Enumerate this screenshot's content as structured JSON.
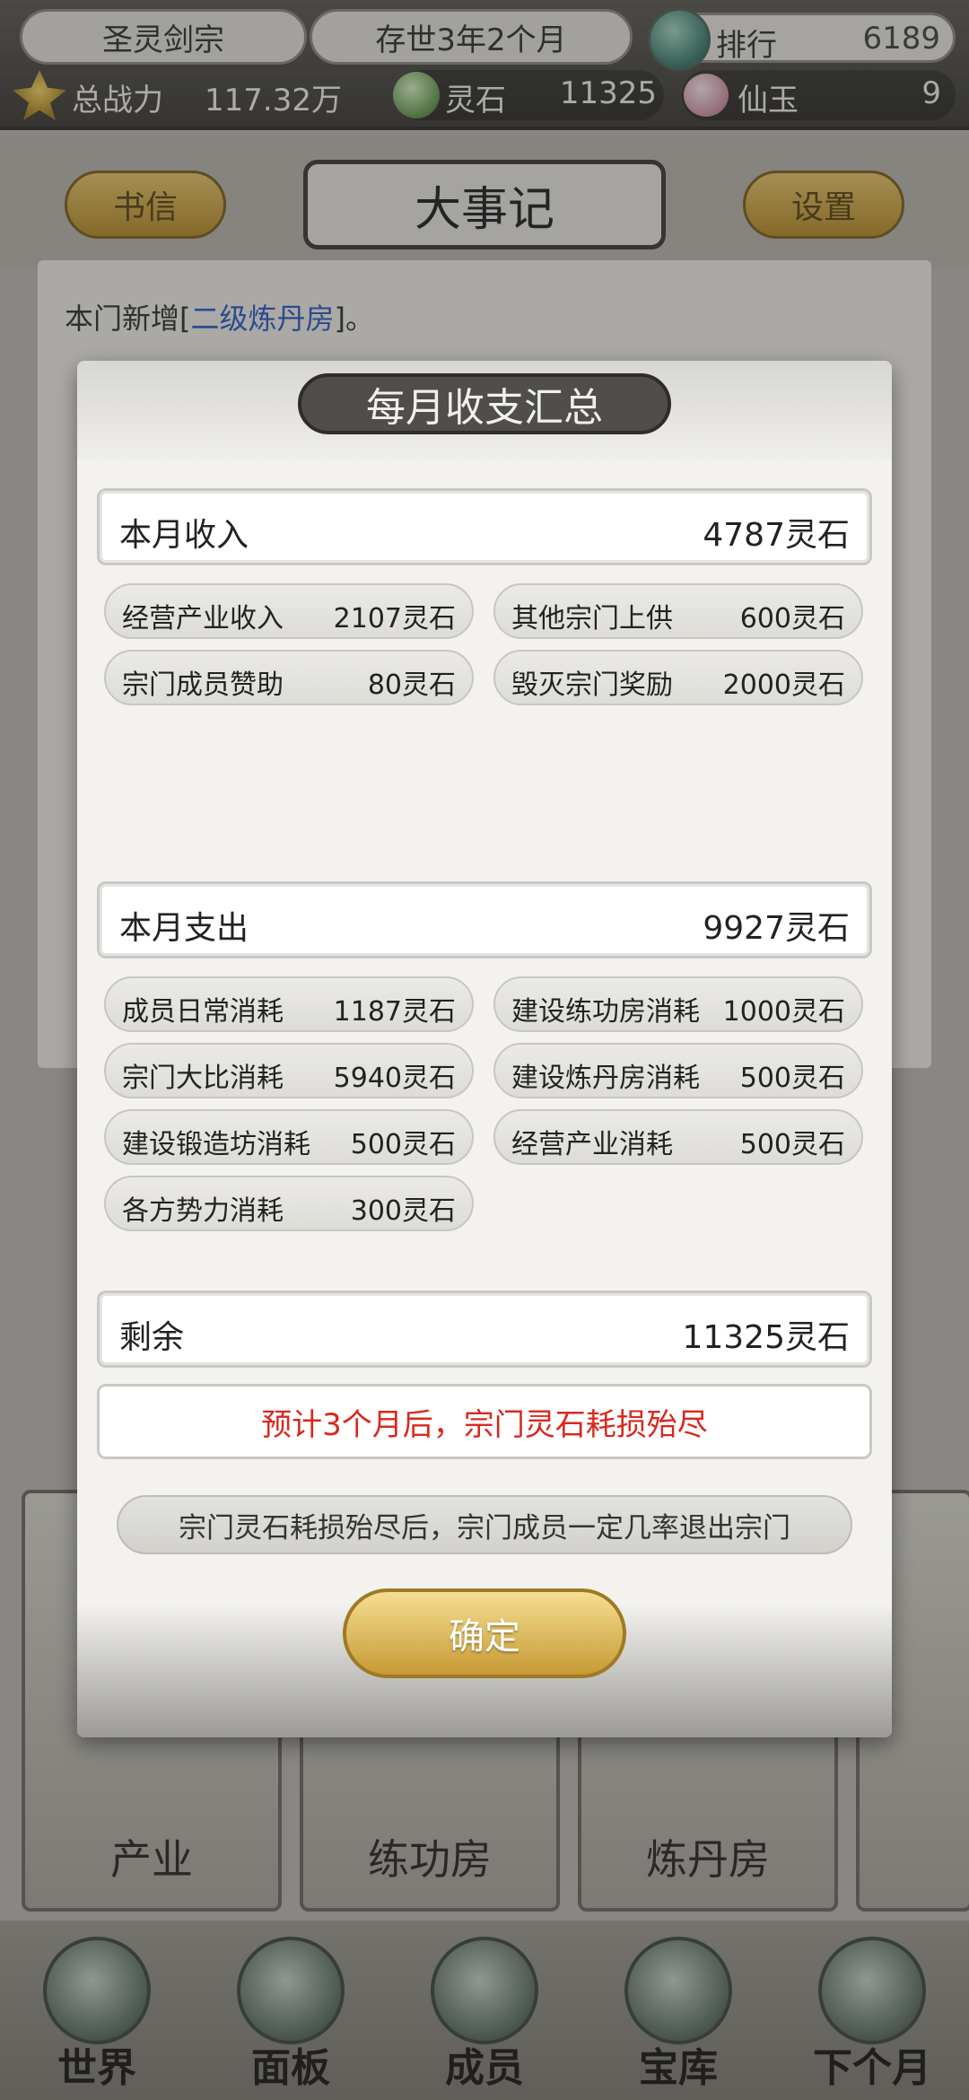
{
  "topbar": {
    "sect_name": "圣灵剑宗",
    "era": "存世3年2个月",
    "rank_label": "排行",
    "rank_value": "6189",
    "power_label": "总战力",
    "power_value": "117.32万",
    "stone_label": "灵石",
    "stone_value": "11325",
    "jade_label": "仙玉",
    "jade_value": "9"
  },
  "header": {
    "letters_button": "书信",
    "title": "大事记",
    "settings_button": "设置"
  },
  "log": {
    "line1_prefix": "本门新增[",
    "line1_highlight": "二级炼丹房",
    "line1_suffix": "]。"
  },
  "buildings": [
    {
      "label": "产业"
    },
    {
      "label": "练功房"
    },
    {
      "label": "炼丹房"
    }
  ],
  "nav": [
    {
      "label": "世界"
    },
    {
      "label": "面板"
    },
    {
      "label": "成员"
    },
    {
      "label": "宝库"
    },
    {
      "label": "下个月"
    }
  ],
  "modal": {
    "title": "每月收支汇总",
    "income": {
      "label": "本月收入",
      "total": "4787灵石",
      "items": [
        {
          "label": "经营产业收入",
          "value": "2107灵石"
        },
        {
          "label": "其他宗门上供",
          "value": "600灵石"
        },
        {
          "label": "宗门成员赞助",
          "value": "80灵石"
        },
        {
          "label": "毁灭宗门奖励",
          "value": "2000灵石"
        }
      ]
    },
    "expense": {
      "label": "本月支出",
      "total": "9927灵石",
      "items": [
        {
          "label": "成员日常消耗",
          "value": "1187灵石"
        },
        {
          "label": "建设练功房消耗",
          "value": "1000灵石"
        },
        {
          "label": "宗门大比消耗",
          "value": "5940灵石"
        },
        {
          "label": "建设炼丹房消耗",
          "value": "500灵石"
        },
        {
          "label": "建设锻造坊消耗",
          "value": "500灵石"
        },
        {
          "label": "经营产业消耗",
          "value": "500灵石"
        },
        {
          "label": "各方势力消耗",
          "value": "300灵石"
        }
      ]
    },
    "remaining": {
      "label": "剩余",
      "value": "11325灵石"
    },
    "warning": "预计3个月后，宗门灵石耗损殆尽",
    "note": "宗门灵石耗损殆尽后，宗门成员一定几率退出宗门",
    "confirm_button": "确定"
  },
  "colors": {
    "warning_text": "#d8291f",
    "confirm_button": "#d9b24f"
  }
}
